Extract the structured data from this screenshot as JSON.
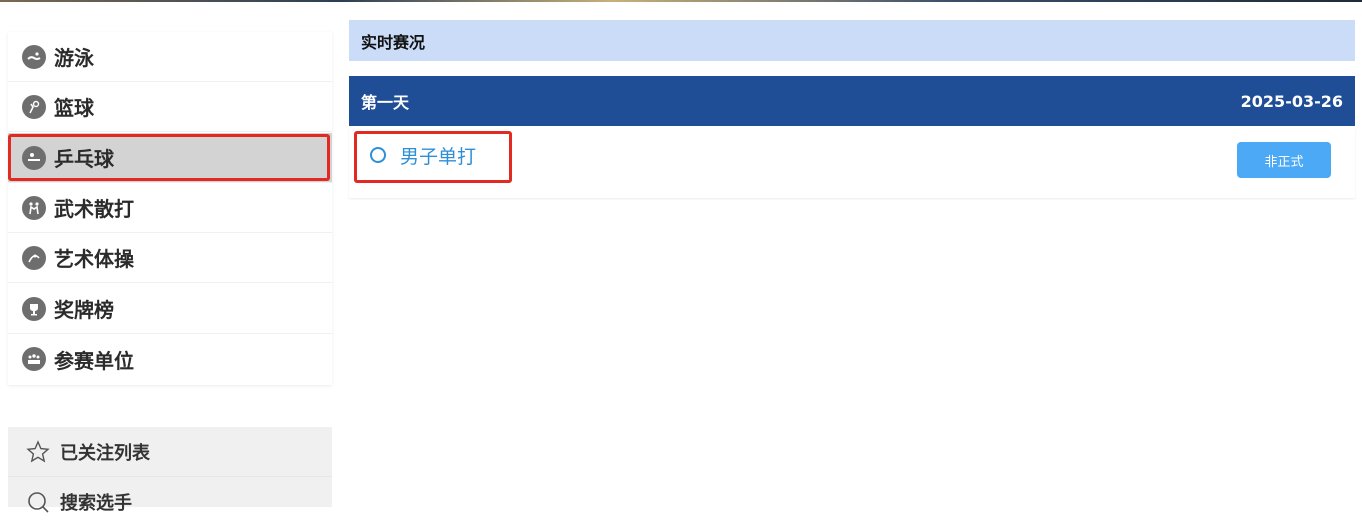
{
  "sidebar": {
    "items": [
      {
        "label": "游泳",
        "icon": "swimming-icon"
      },
      {
        "label": "篮球",
        "icon": "basketball-icon"
      },
      {
        "label": "乒乓球",
        "icon": "table-tennis-icon",
        "active": true
      },
      {
        "label": "武术散打",
        "icon": "martial-arts-icon"
      },
      {
        "label": "艺术体操",
        "icon": "gymnastics-icon"
      },
      {
        "label": "奖牌榜",
        "icon": "trophy-icon"
      },
      {
        "label": "参赛单位",
        "icon": "team-icon"
      }
    ],
    "secondary": [
      {
        "label": "已关注列表",
        "icon": "star-icon"
      },
      {
        "label": "搜索选手",
        "icon": "search-icon"
      }
    ]
  },
  "main": {
    "section_title": "实时赛况",
    "day": {
      "label": "第一天",
      "date": "2025-03-26"
    },
    "events": [
      {
        "name": "男子单打",
        "status": "非正式"
      }
    ]
  },
  "colors": {
    "section_bg": "#cadcf7",
    "day_bar_bg": "#1f4e96",
    "link": "#2d8fd8",
    "badge_bg": "#4ba9f5",
    "highlight": "#e02a22"
  }
}
